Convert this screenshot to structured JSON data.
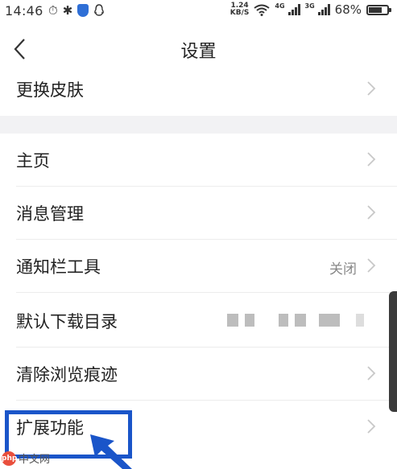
{
  "status_bar": {
    "time": "14:46",
    "speed_value": "1.24",
    "speed_unit": "KB/S",
    "net_a": "4G",
    "net_b": "3G",
    "battery_percent": "68%"
  },
  "header": {
    "title": "设置"
  },
  "settings": {
    "skin": "更换皮肤",
    "home": "主页",
    "messages": "消息管理",
    "notification_tools": "通知栏工具",
    "notification_tools_value": "关闭",
    "download_dir": "默认下载目录",
    "clear_history": "清除浏览痕迹",
    "extensions": "扩展功能"
  },
  "watermark": {
    "logo": "php",
    "text": "中文网"
  },
  "colors": {
    "highlight": "#1a55c9",
    "section_gap": "#f2f2f4"
  }
}
